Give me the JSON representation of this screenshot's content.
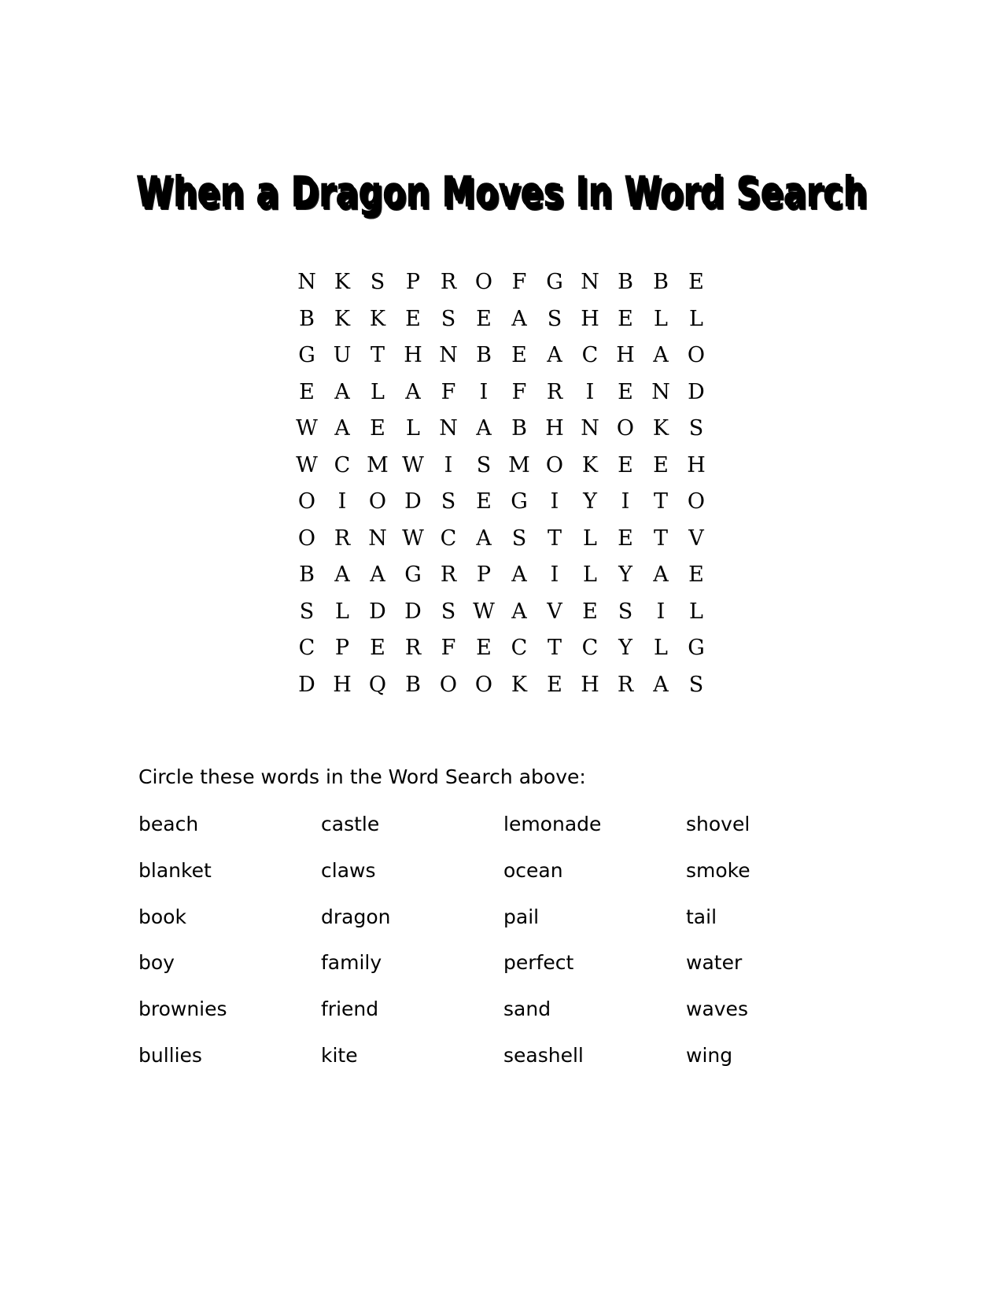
{
  "document": {
    "title": "When a Dragon Moves In Word Search",
    "background_color": "#ffffff",
    "text_color": "#000000"
  },
  "puzzle": {
    "rows": 12,
    "cols": 12,
    "letters": [
      [
        "N",
        "K",
        "S",
        "P",
        "R",
        "O",
        "F",
        "G",
        "N",
        "B",
        "B",
        "E"
      ],
      [
        "B",
        "K",
        "K",
        "E",
        "S",
        "E",
        "A",
        "S",
        "H",
        "E",
        "L",
        "L"
      ],
      [
        "G",
        "U",
        "T",
        "H",
        "N",
        "B",
        "E",
        "A",
        "C",
        "H",
        "A",
        "O"
      ],
      [
        "E",
        "A",
        "L",
        "A",
        "F",
        "I",
        "F",
        "R",
        "I",
        "E",
        "N",
        "D"
      ],
      [
        "W",
        "A",
        "E",
        "L",
        "N",
        "A",
        "B",
        "H",
        "N",
        "O",
        "K",
        "S"
      ],
      [
        "W",
        "C",
        "M",
        "W",
        "I",
        "S",
        "M",
        "O",
        "K",
        "E",
        "E",
        "H"
      ],
      [
        "O",
        "I",
        "O",
        "D",
        "S",
        "E",
        "G",
        "I",
        "Y",
        "I",
        "T",
        "O"
      ],
      [
        "O",
        "R",
        "N",
        "W",
        "C",
        "A",
        "S",
        "T",
        "L",
        "E",
        "T",
        "V"
      ],
      [
        "B",
        "A",
        "A",
        "G",
        "R",
        "P",
        "A",
        "I",
        "L",
        "Y",
        "A",
        "E"
      ],
      [
        "S",
        "L",
        "D",
        "D",
        "S",
        "W",
        "A",
        "V",
        "E",
        "S",
        "I",
        "L"
      ],
      [
        "C",
        "P",
        "E",
        "R",
        "F",
        "E",
        "C",
        "T",
        "C",
        "Y",
        "L",
        "G"
      ],
      [
        "D",
        "H",
        "Q",
        "B",
        "O",
        "O",
        "K",
        "E",
        "H",
        "R",
        "A",
        "S"
      ]
    ]
  },
  "instruction": {
    "text": "Circle these words in the Word Search above:"
  },
  "word_list": {
    "columns": 4,
    "rows": 6,
    "grid": [
      [
        "beach",
        "castle",
        "lemonade",
        "shovel"
      ],
      [
        "blanket",
        "claws",
        "ocean",
        "smoke"
      ],
      [
        "book",
        "dragon",
        "pail",
        "tail"
      ],
      [
        "boy",
        "family",
        "perfect",
        "water"
      ],
      [
        "brownies",
        "friend",
        "sand",
        "waves"
      ],
      [
        "bullies",
        "kite",
        "seashell",
        "wing"
      ]
    ],
    "words": [
      "beach",
      "castle",
      "lemonade",
      "shovel",
      "blanket",
      "claws",
      "ocean",
      "smoke",
      "book",
      "dragon",
      "pail",
      "tail",
      "boy",
      "family",
      "perfect",
      "water",
      "brownies",
      "friend",
      "sand",
      "waves",
      "bullies",
      "kite",
      "seashell",
      "wing"
    ]
  }
}
